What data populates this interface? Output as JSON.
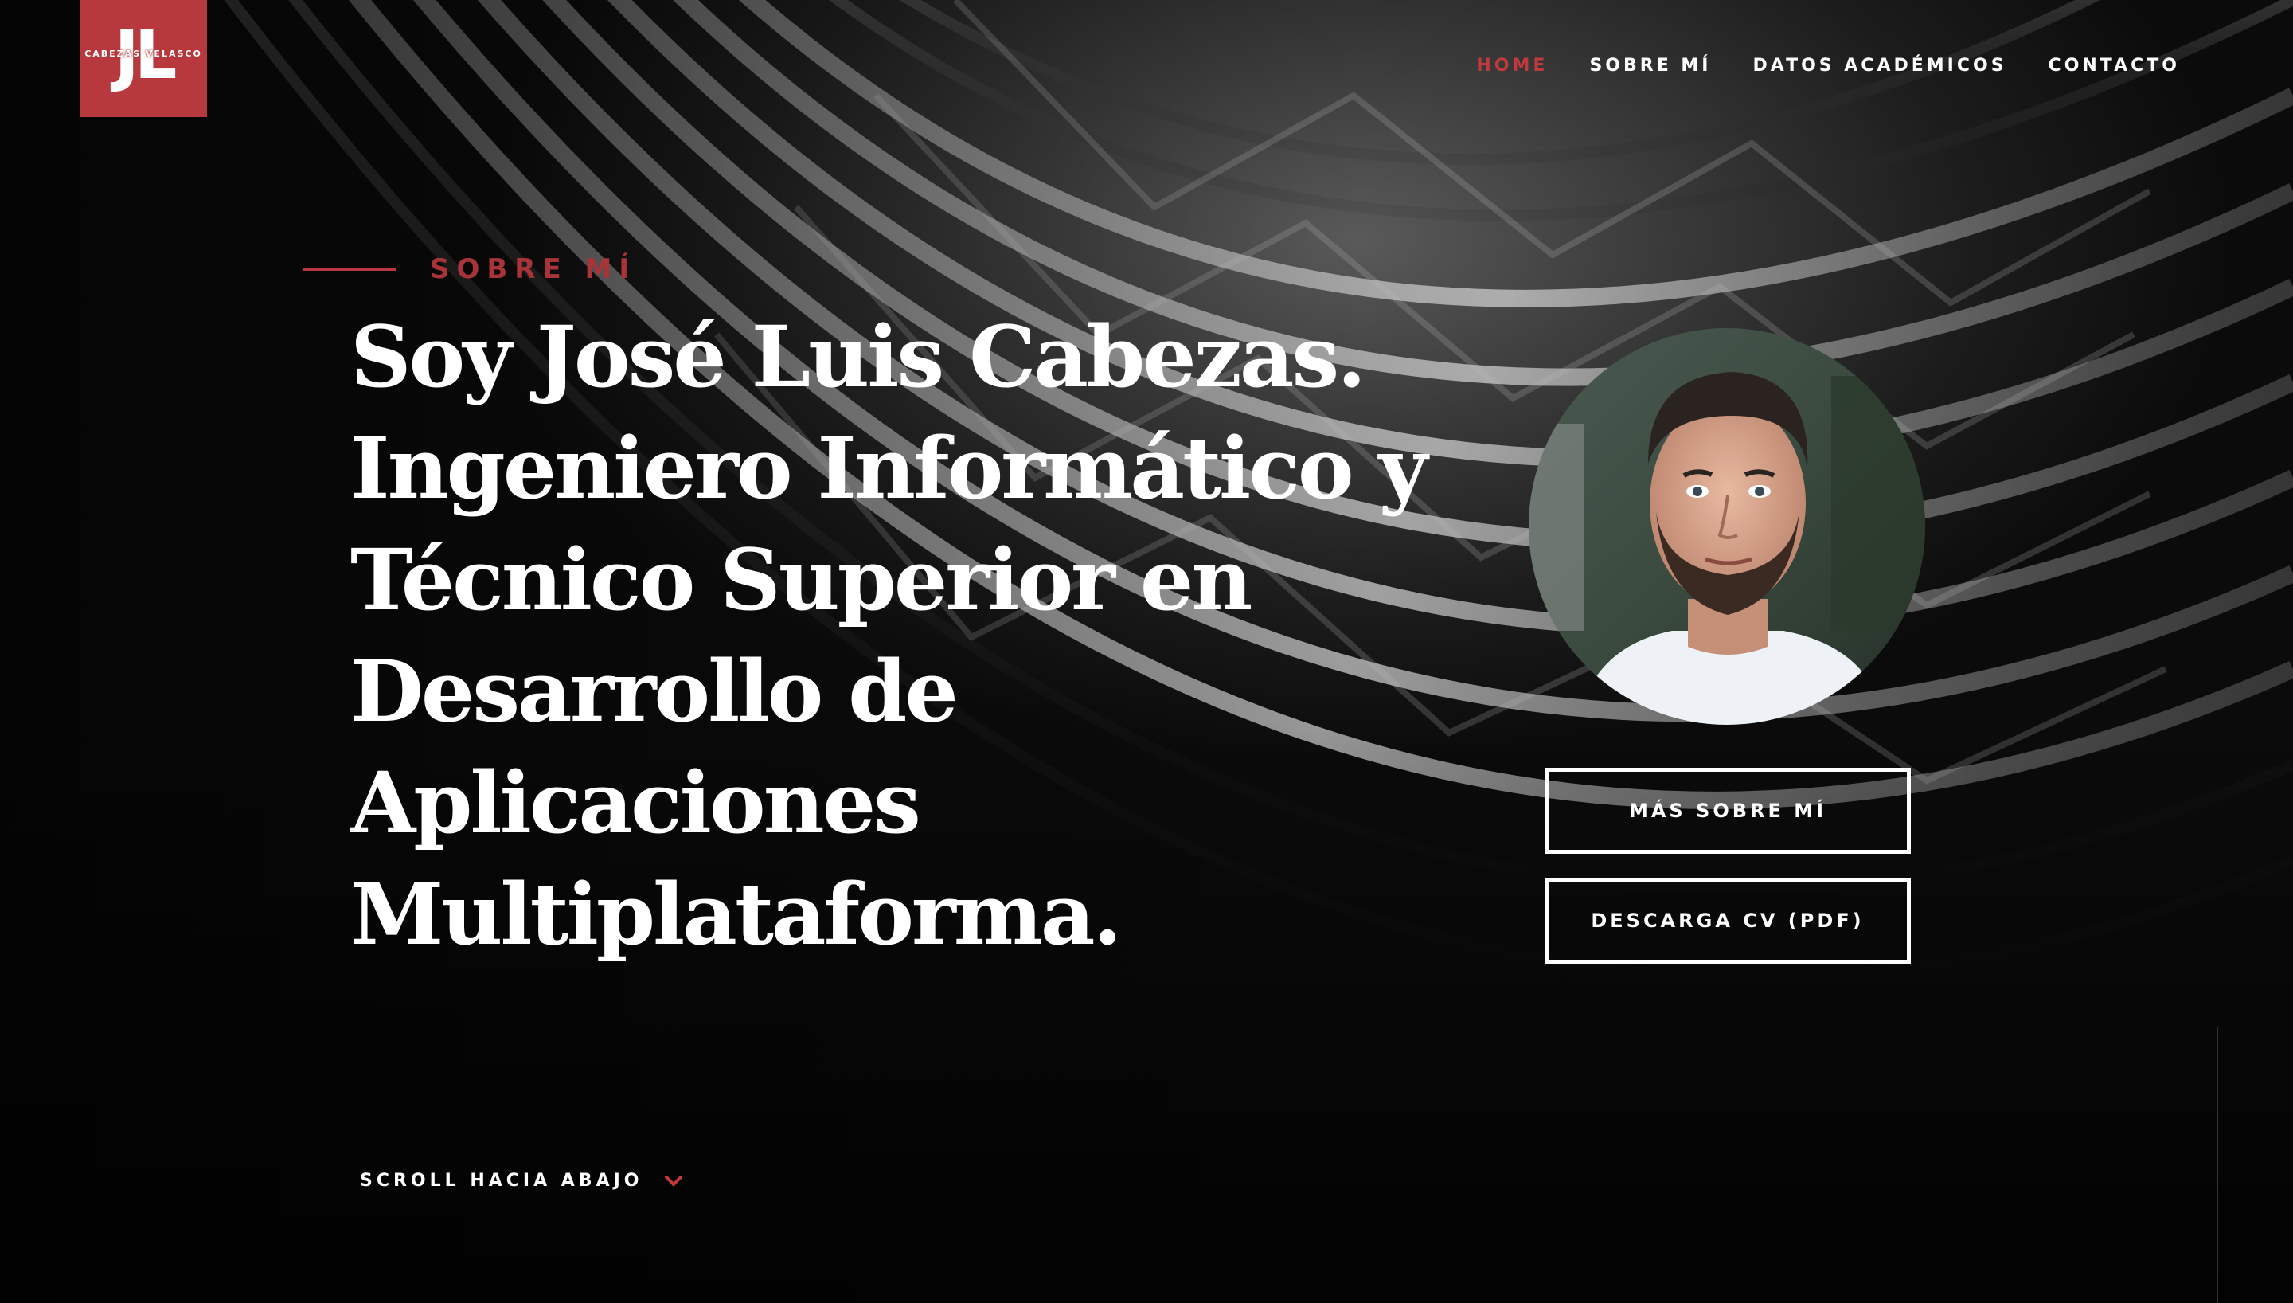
{
  "brand": {
    "logo_letters": "JL",
    "logo_subtitle": "CABEZAS VELASCO",
    "accent_color": "#b8393d"
  },
  "nav": {
    "items": [
      {
        "label": "HOME",
        "active": true
      },
      {
        "label": "SOBRE MÍ",
        "active": false
      },
      {
        "label": "DATOS ACADÉMICOS",
        "active": false
      },
      {
        "label": "CONTACTO",
        "active": false
      }
    ]
  },
  "hero": {
    "eyebrow": "SOBRE MÍ",
    "headline_lines": [
      "Soy José Luis Cabezas.",
      "Ingeniero Informático y",
      "Técnico Superior en",
      "Desarrollo de",
      "Aplicaciones",
      "Multiplataforma."
    ],
    "buttons": {
      "more_label": "MÁS SOBRE MÍ",
      "cv_label": "DESCARGA CV (PDF)"
    },
    "scroll_label": "SCROLL HACIA ABAJO",
    "scroll_icon": "chevron-down-icon"
  }
}
